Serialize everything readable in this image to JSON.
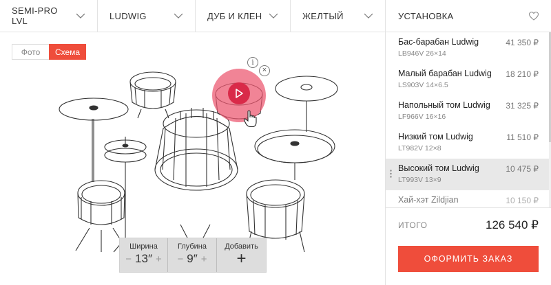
{
  "filters": [
    {
      "label": "SEMI-PRO LVL"
    },
    {
      "label": "LUDWIG"
    },
    {
      "label": "ДУБ И КЛЕН"
    },
    {
      "label": "ЖЕЛТЫЙ"
    }
  ],
  "install_label": "УСТАНОВКА",
  "view_toggle": {
    "photo": "Фото",
    "scheme": "Схема",
    "active": "scheme"
  },
  "hotspot": {
    "info_glyph": "i",
    "close_glyph": "×"
  },
  "size_controls": {
    "width_label": "Ширина",
    "width_value": "13″",
    "depth_label": "Глубина",
    "depth_value": "9″",
    "add_label": "Добавить",
    "minus": "−",
    "plus": "+",
    "add_plus": "+"
  },
  "items": [
    {
      "name": "Бас-барабан Ludwig",
      "sku": "LB946V 26×14",
      "price": "41 350 ₽"
    },
    {
      "name": "Малый барабан Ludwig",
      "sku": "LS903V 14×6.5",
      "price": "18 210 ₽"
    },
    {
      "name": "Напольный том Ludwig",
      "sku": "LF966V 16×16",
      "price": "31 325 ₽"
    },
    {
      "name": "Низкий том Ludwig",
      "sku": "LT982V 12×8",
      "price": "11 510 ₽"
    },
    {
      "name": "Высокий том Ludwig",
      "sku": "LT993V 13×9",
      "price": "10 475 ₽"
    },
    {
      "name": "Хай-хэт Zildjian",
      "sku": "",
      "price": "10 150 ₽"
    }
  ],
  "total": {
    "label": "ИТОГО",
    "value": "126 540 ₽"
  },
  "order_button": "ОФОРМИТЬ ЗАКАЗ",
  "colors": {
    "accent": "#ef4d3b",
    "hotspot": "#ec546e",
    "hotspot_inner": "#d92a49"
  }
}
